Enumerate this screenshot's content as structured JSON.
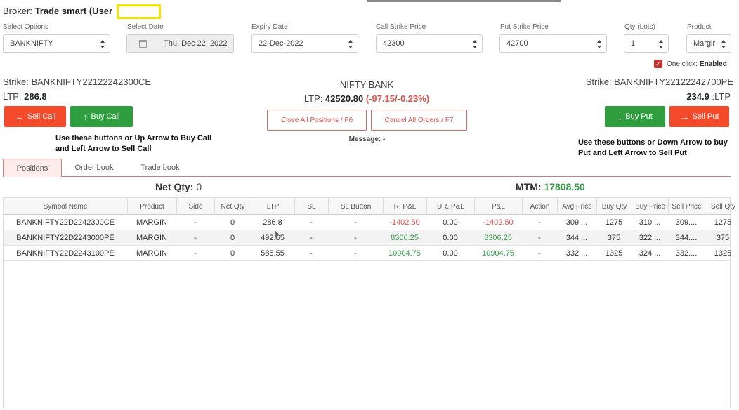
{
  "broker": {
    "label": "Broker:",
    "name": "Trade smart (User"
  },
  "form": {
    "select_options": {
      "label": "Select Options",
      "value": "BANKNIFTY"
    },
    "select_date": {
      "label": "Select Date",
      "value": "Thu, Dec 22, 2022"
    },
    "expiry_date": {
      "label": "Expiry Date",
      "value": "22-Dec-2022"
    },
    "call_strike": {
      "label": "Call Strike Price",
      "value": "42300"
    },
    "put_strike": {
      "label": "Put Strike Price",
      "value": "42700"
    },
    "qty": {
      "label": "Qty (Lots)",
      "value": "1"
    },
    "product": {
      "label": "Product",
      "value": "Margir"
    }
  },
  "one_click": {
    "label": "One click:",
    "status": "Enabled"
  },
  "call": {
    "strike_label": "Strike: BANKNIFTY22122242300CE",
    "ltp_label": "LTP:",
    "ltp": "286.8",
    "sell_label": "Sell Call",
    "buy_label": "Buy Call",
    "note": "Use these buttons or Up Arrow to Buy Call and Left Arrow to Sell Call"
  },
  "index": {
    "name": "NIFTY BANK",
    "ltp_label": "LTP:",
    "ltp": "42520.80",
    "change": "(-97.15/-0.23%)",
    "close_all_label": "Close All Positions / F6",
    "cancel_all_label": "Cancel All Orders / F7",
    "message": "Message: -"
  },
  "put": {
    "strike_label": "Strike: BANKNIFTY22122242700PE",
    "ltp": "234.9",
    "ltp_label": ":LTP",
    "buy_label": "Buy Put",
    "sell_label": "Sell Put",
    "note": "Use these buttons or Down Arrow to buy Put and Left Arrow to Sell Put"
  },
  "tabs": [
    "Positions",
    "Order book",
    "Trade book"
  ],
  "summary": {
    "net_qty_label": "Net Qty:",
    "net_qty": "0",
    "mtm_label": "MTM:",
    "mtm": "17808.50"
  },
  "table": {
    "columns": [
      "Symbol Name",
      "Product",
      "Side",
      "Net Qty",
      "LTP",
      "SL",
      "SL Button",
      "R. P&L",
      "UR. P&L",
      "P&L",
      "Action",
      "Avg Price",
      "Buy Qty",
      "Buy Price",
      "Sell Price",
      "Sell Qty"
    ],
    "rows": [
      [
        "BANKNIFTY22D2242300CE",
        "MARGIN",
        "-",
        "0",
        "286.8",
        "-",
        "-",
        "-1402.50",
        "0.00",
        "-1402.50",
        "-",
        "309....",
        "1275",
        "310....",
        "309....",
        "1275"
      ],
      [
        "BANKNIFTY22D2243000PE",
        "MARGIN",
        "-",
        "0",
        "492.65",
        "-",
        "-",
        "8306.25",
        "0.00",
        "8306.25",
        "-",
        "344....",
        "375",
        "322....",
        "344....",
        "375"
      ],
      [
        "BANKNIFTY22D2243100PE",
        "MARGIN",
        "-",
        "0",
        "585.55",
        "-",
        "-",
        "10904.75",
        "0.00",
        "10904.75",
        "-",
        "332....",
        "1325",
        "324....",
        "332....",
        "1325"
      ]
    ]
  },
  "colors": {
    "sell": "#f24a2b",
    "buy": "#2e9e3e",
    "negative": "#d9534f",
    "positive": "#3a9d4a"
  }
}
